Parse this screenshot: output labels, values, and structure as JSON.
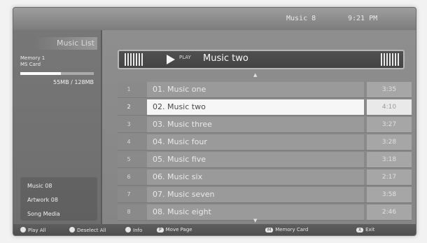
{
  "header": {
    "index_label": "Music 8",
    "time_label": "9:21 PM"
  },
  "sidebar": {
    "title": "Music List",
    "memory_label": "Memory 1",
    "memory_sub": "MS Card",
    "usage_percent": 55,
    "usage_text": "55MB / 128MB",
    "stats": [
      "Music 08",
      "Artwork 08",
      "Song Media"
    ]
  },
  "player": {
    "status_label": "PLAY",
    "now_playing": "Music two"
  },
  "tracks": [
    {
      "num": "1",
      "name": "01. Music one",
      "time": "3:35"
    },
    {
      "num": "2",
      "name": "02. Music two",
      "time": "4:10",
      "selected": true
    },
    {
      "num": "3",
      "name": "03. Music three",
      "time": "3:27"
    },
    {
      "num": "4",
      "name": "04. Music four",
      "time": "3:28"
    },
    {
      "num": "5",
      "name": "05. Music five",
      "time": "3:18"
    },
    {
      "num": "6",
      "name": "06. Music six",
      "time": "2:17"
    },
    {
      "num": "7",
      "name": "07. Music seven",
      "time": "3:58"
    },
    {
      "num": "8",
      "name": "08. Music eight",
      "time": "2:46"
    }
  ],
  "footer": {
    "play": "Play All",
    "select": "Deselect All",
    "info": "Info",
    "page": "Move Page",
    "memory": "Memory Card",
    "exit": "Exit"
  }
}
